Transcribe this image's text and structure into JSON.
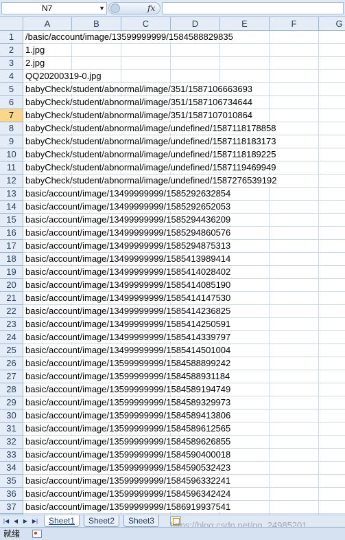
{
  "formula_bar": {
    "name_box": "N7",
    "fx_label": "fx",
    "formula": ""
  },
  "columns": [
    "A",
    "B",
    "C",
    "D",
    "E",
    "F",
    "G"
  ],
  "active_row": 7,
  "rows": [
    {
      "n": "1",
      "a": "/basic/account/image/13599999999/1584588829835"
    },
    {
      "n": "2",
      "a": "1.jpg"
    },
    {
      "n": "3",
      "a": "2.jpg"
    },
    {
      "n": "4",
      "a": "QQ20200319-0.jpg"
    },
    {
      "n": "5",
      "a": "babyCheck/student/abnormal/image/351/1587106663693"
    },
    {
      "n": "6",
      "a": "babyCheck/student/abnormal/image/351/1587106734644"
    },
    {
      "n": "7",
      "a": "babyCheck/student/abnormal/image/351/1587107010864"
    },
    {
      "n": "8",
      "a": "babyCheck/student/abnormal/image/undefined/1587118178858"
    },
    {
      "n": "9",
      "a": "babyCheck/student/abnormal/image/undefined/1587118183173"
    },
    {
      "n": "10",
      "a": "babyCheck/student/abnormal/image/undefined/1587118189225"
    },
    {
      "n": "11",
      "a": "babyCheck/student/abnormal/image/undefined/1587119469949"
    },
    {
      "n": "12",
      "a": "babyCheck/student/abnormal/image/undefined/1587276539192"
    },
    {
      "n": "13",
      "a": "basic/account/image/13499999999/1585292632854"
    },
    {
      "n": "14",
      "a": "basic/account/image/13499999999/1585292652053"
    },
    {
      "n": "15",
      "a": "basic/account/image/13499999999/1585294436209"
    },
    {
      "n": "16",
      "a": "basic/account/image/13499999999/1585294860576"
    },
    {
      "n": "17",
      "a": "basic/account/image/13499999999/1585294875313"
    },
    {
      "n": "18",
      "a": "basic/account/image/13499999999/1585413989414"
    },
    {
      "n": "19",
      "a": "basic/account/image/13499999999/1585414028402"
    },
    {
      "n": "20",
      "a": "basic/account/image/13499999999/1585414085190"
    },
    {
      "n": "21",
      "a": "basic/account/image/13499999999/1585414147530"
    },
    {
      "n": "22",
      "a": "basic/account/image/13499999999/1585414236825"
    },
    {
      "n": "23",
      "a": "basic/account/image/13499999999/1585414250591"
    },
    {
      "n": "24",
      "a": "basic/account/image/13499999999/1585414339797"
    },
    {
      "n": "25",
      "a": "basic/account/image/13499999999/1585414501004"
    },
    {
      "n": "26",
      "a": "basic/account/image/13599999999/1584588899242"
    },
    {
      "n": "27",
      "a": "basic/account/image/13599999999/1584588931184"
    },
    {
      "n": "28",
      "a": "basic/account/image/13599999999/1584589194749"
    },
    {
      "n": "29",
      "a": "basic/account/image/13599999999/1584589329973"
    },
    {
      "n": "30",
      "a": "basic/account/image/13599999999/1584589413806"
    },
    {
      "n": "31",
      "a": "basic/account/image/13599999999/1584589612565"
    },
    {
      "n": "32",
      "a": "basic/account/image/13599999999/1584589626855"
    },
    {
      "n": "33",
      "a": "basic/account/image/13599999999/1584590400018"
    },
    {
      "n": "34",
      "a": "basic/account/image/13599999999/1584590532423"
    },
    {
      "n": "35",
      "a": "basic/account/image/13599999999/1584596332241"
    },
    {
      "n": "36",
      "a": "basic/account/image/13599999999/1584596342424"
    },
    {
      "n": "37",
      "a": "basic/account/image/13599999999/1586919937541"
    }
  ],
  "sheet_tabs": {
    "tabs": [
      "Sheet1",
      "Sheet2",
      "Sheet3"
    ],
    "active": 0
  },
  "status_bar": {
    "status": "就绪"
  },
  "watermark": "https://blog.csdn.net/qq_24985201"
}
